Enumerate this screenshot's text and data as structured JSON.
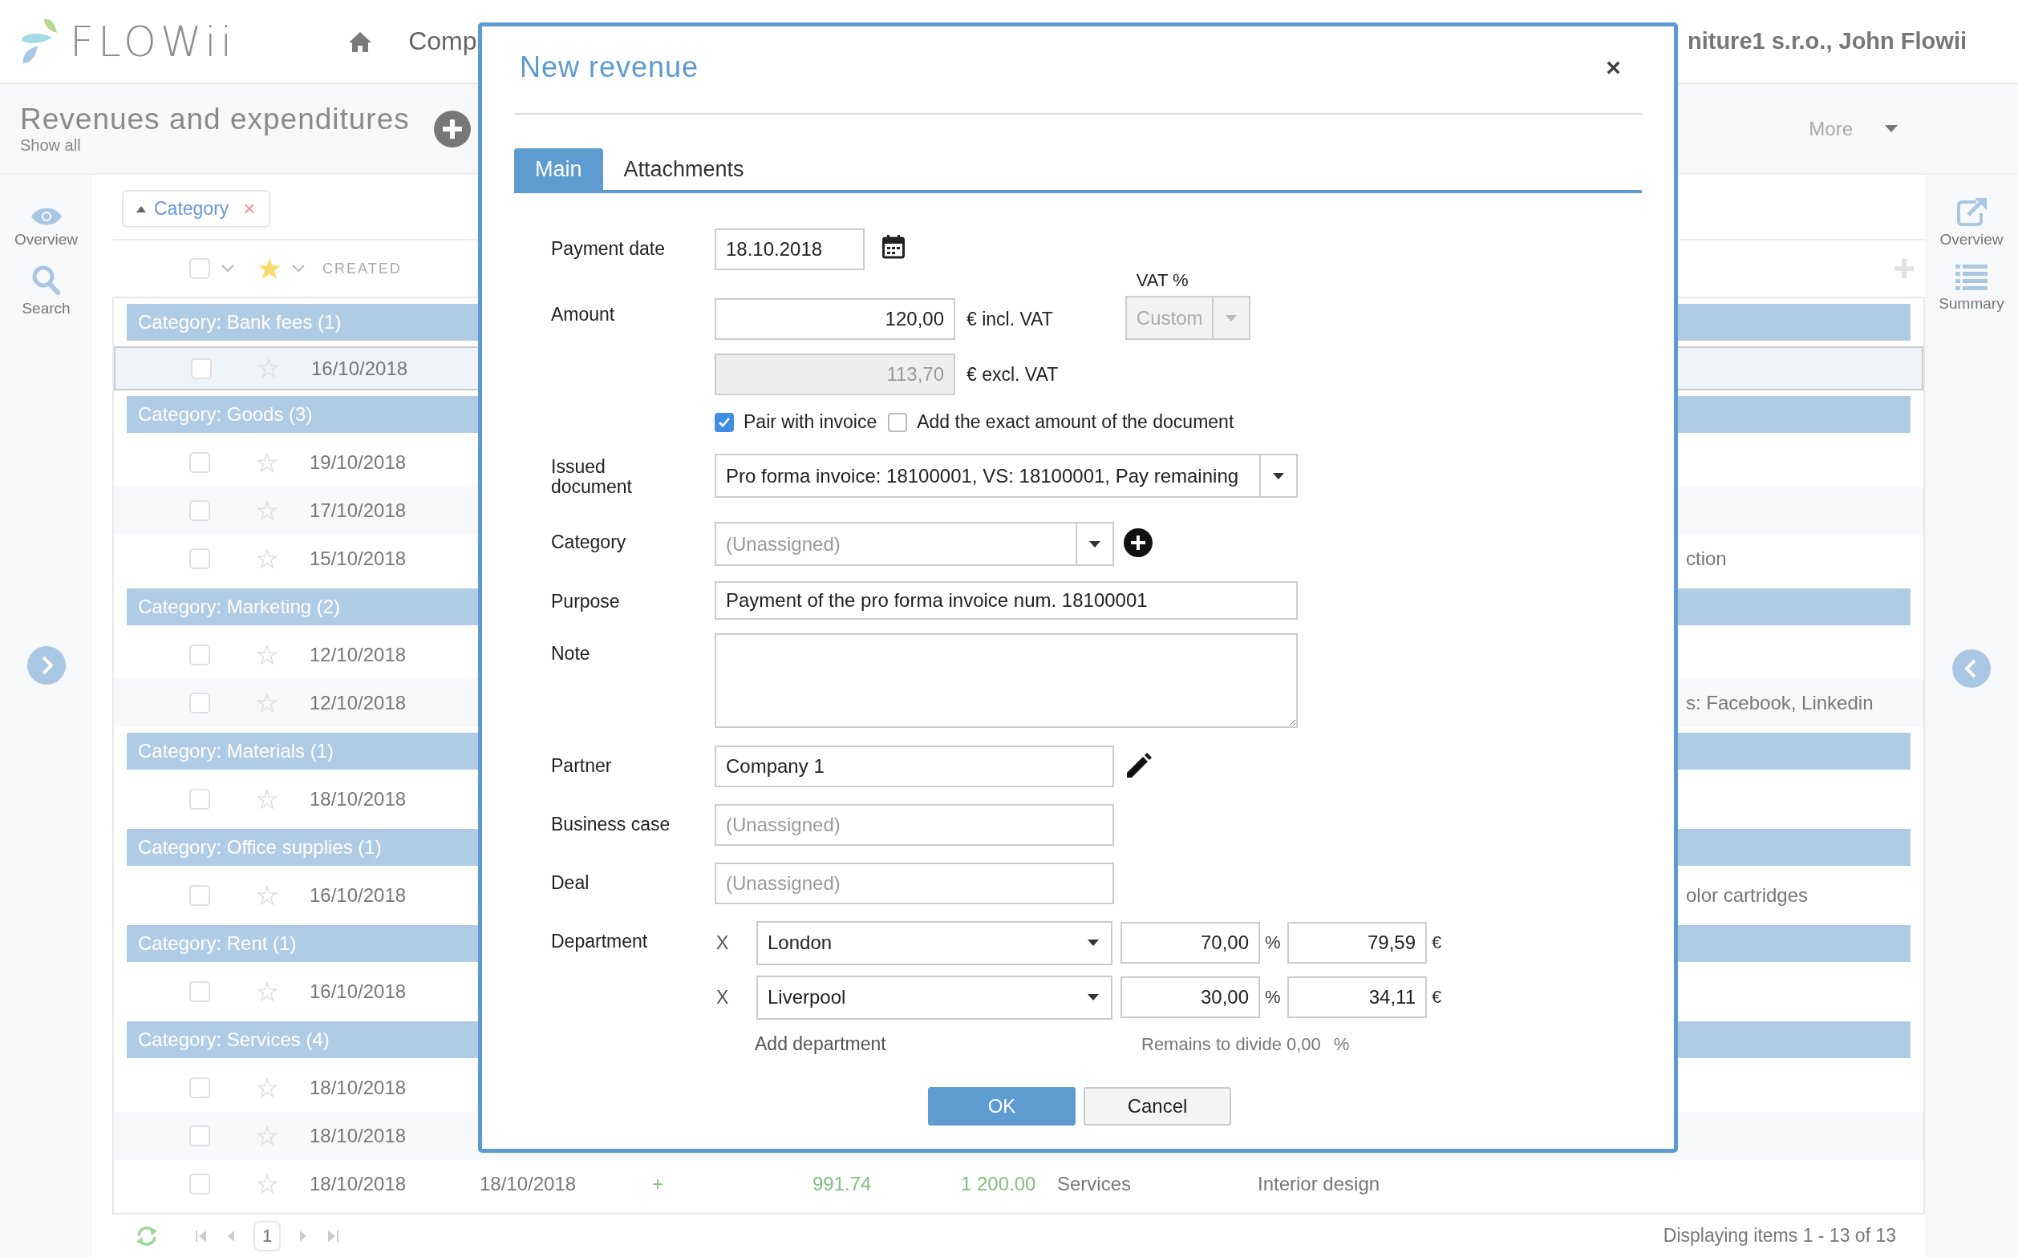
{
  "header": {
    "logo": "FLOWii",
    "nav_partial": "Comp",
    "account_partial": "niture1 s.r.o., John Flowii"
  },
  "page": {
    "title": "Revenues and expenditures",
    "subtitle": "Show all",
    "more": "More"
  },
  "left_sidebar": [
    {
      "label": "Overview",
      "kind": "eye"
    },
    {
      "label": "Search",
      "kind": "search"
    }
  ],
  "right_sidebar": [
    {
      "label": "Overview",
      "kind": "external"
    },
    {
      "label": "Summary",
      "kind": "list"
    }
  ],
  "filter": {
    "label": "Category",
    "remove": "×"
  },
  "table": {
    "header_checked": false,
    "columns": [
      "CREATED"
    ],
    "groups": [
      {
        "title": "Category: Bank fees (1)",
        "rows": [
          {
            "date": "16/10/2018",
            "checked": false,
            "starred": false,
            "selected": true
          }
        ]
      },
      {
        "title": "Category: Goods (3)",
        "rows": [
          {
            "date": "19/10/2018",
            "checked": false,
            "starred": false,
            "selected": false
          },
          {
            "date": "17/10/2018",
            "checked": false,
            "starred": false,
            "selected": false
          },
          {
            "date": "15/10/2018",
            "checked": false,
            "starred": false,
            "selected": false,
            "tail": "ction"
          }
        ]
      },
      {
        "title": "Category: Marketing (2)",
        "rows": [
          {
            "date": "12/10/2018",
            "checked": false,
            "starred": false,
            "selected": false
          },
          {
            "date": "12/10/2018",
            "checked": false,
            "starred": false,
            "selected": false,
            "tail": "s: Facebook, Linkedin"
          }
        ]
      },
      {
        "title": "Category: Materials (1)",
        "rows": [
          {
            "date": "18/10/2018",
            "checked": false,
            "starred": false,
            "selected": false
          }
        ]
      },
      {
        "title": "Category: Office supplies (1)",
        "rows": [
          {
            "date": "16/10/2018",
            "checked": false,
            "starred": false,
            "selected": false,
            "tail": "olor cartridges"
          }
        ]
      },
      {
        "title": "Category: Rent (1)",
        "rows": [
          {
            "date": "16/10/2018",
            "checked": false,
            "starred": false,
            "selected": false
          }
        ]
      },
      {
        "title": "Category: Services (4)",
        "rows": [
          {
            "date": "18/10/2018",
            "checked": false,
            "starred": false,
            "selected": false
          },
          {
            "date": "18/10/2018",
            "checked": false,
            "starred": false,
            "selected": false
          },
          {
            "date": "18/10/2018",
            "checked": false,
            "starred": false,
            "selected": false,
            "cells": [
              "18/10/2018",
              "+",
              "991.74",
              "1 200.00",
              "Services",
              "Interior design"
            ]
          }
        ]
      }
    ]
  },
  "pager": {
    "page": "1",
    "summary": "Displaying items 1 - 13 of 13"
  },
  "dialog": {
    "title": "New revenue",
    "close": "×",
    "tabs": [
      {
        "label": "Main",
        "selected": true
      },
      {
        "label": "Attachments",
        "selected": false
      }
    ],
    "payment_date": {
      "label": "Payment date",
      "value": "18.10.2018"
    },
    "amount": {
      "label": "Amount",
      "incl_value": "120,00",
      "incl_unit": "€ incl. VAT",
      "excl_value": "113,70",
      "excl_disabled": true,
      "excl_unit": "€ excl. VAT",
      "vat_label": "VAT %",
      "vat_value": "Custom",
      "vat_disabled": true
    },
    "options": [
      {
        "label": "Pair with invoice",
        "checked": true
      },
      {
        "label": "Add the exact amount of the document",
        "checked": false
      }
    ],
    "issued_document": {
      "label": "Issued document",
      "value": "Pro forma invoice: 18100001, VS: 18100001, Pay remaining"
    },
    "category": {
      "label": "Category",
      "placeholder": "(Unassigned)"
    },
    "purpose": {
      "label": "Purpose",
      "value": "Payment of the pro forma invoice num. 18100001"
    },
    "note": {
      "label": "Note"
    },
    "partner": {
      "label": "Partner",
      "value": "Company 1"
    },
    "business_case": {
      "label": "Business case",
      "placeholder": "(Unassigned)"
    },
    "deal": {
      "label": "Deal",
      "placeholder": "(Unassigned)"
    },
    "department": {
      "label": "Department",
      "rows": [
        {
          "remove": "X",
          "name": "London",
          "percent": "70,00",
          "percent_unit": "%",
          "amount": "79,59",
          "currency": "€"
        },
        {
          "remove": "X",
          "name": "Liverpool",
          "percent": "30,00",
          "percent_unit": "%",
          "amount": "34,11",
          "currency": "€"
        }
      ],
      "add": "Add department",
      "remains": "Remains to divide 0,00",
      "remains_unit": "%"
    },
    "buttons": [
      {
        "label": "OK",
        "kind": "primary"
      },
      {
        "label": "Cancel",
        "kind": "secondary"
      }
    ]
  }
}
